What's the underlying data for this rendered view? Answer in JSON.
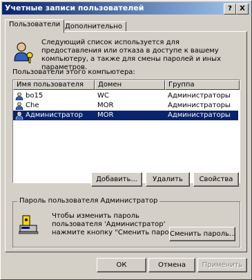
{
  "window": {
    "title": "Учетные записи пользователей",
    "help_button": "?",
    "close_button": "X"
  },
  "tabs": [
    {
      "label": "Пользователи"
    },
    {
      "label": "Дополнительно"
    }
  ],
  "intro_text": "Следующий список используется для предоставления или отказа в доступе к вашему компьютеру, а также для смены паролей и иных параметров.",
  "users_label": "Пользователи этого компьютера:",
  "table": {
    "columns": [
      "Имя пользователя",
      "Домен",
      "Группа"
    ],
    "rows": [
      {
        "name": "bo15",
        "domain": "WC",
        "group": "Администраторы"
      },
      {
        "name": "Che",
        "domain": "MOR",
        "group": "Администраторы"
      },
      {
        "name": "Администратор",
        "domain": "MOR",
        "group": "Администраторы"
      }
    ]
  },
  "buttons": {
    "add": "Добавить...",
    "remove": "Удалить",
    "properties": "Свойства"
  },
  "password_group": {
    "legend": "Пароль пользователя Администратор",
    "text": "Чтобы изменить пароль пользователя 'Администратор' нажмите кнопку \"Сменить пароль\".",
    "change_button": "Сменить пароль..."
  },
  "dialog_buttons": {
    "ok": "ОК",
    "cancel": "Отмена",
    "apply": "Применить"
  },
  "colors": {
    "selection": "#0a246a",
    "face": "#d4d0c8"
  }
}
